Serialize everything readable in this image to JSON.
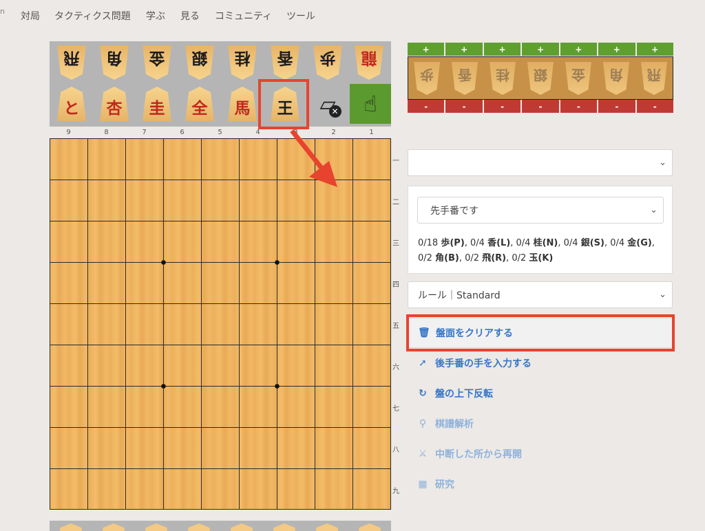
{
  "nav": {
    "items": [
      "対局",
      "タクティクス問題",
      "学ぶ",
      "見る",
      "コミュニティ",
      "ツール"
    ]
  },
  "palette": {
    "top_row": [
      {
        "glyph": "飛",
        "style": "black",
        "inverted": true,
        "icon": "rook-piece-icon"
      },
      {
        "glyph": "角",
        "style": "black",
        "inverted": true,
        "icon": "bishop-piece-icon"
      },
      {
        "glyph": "金",
        "style": "black",
        "inverted": true,
        "icon": "gold-piece-icon"
      },
      {
        "glyph": "銀",
        "style": "black",
        "inverted": true,
        "icon": "silver-piece-icon"
      },
      {
        "glyph": "桂",
        "style": "black",
        "inverted": true,
        "icon": "knight-piece-icon"
      },
      {
        "glyph": "香",
        "style": "black",
        "inverted": true,
        "icon": "lance-piece-icon"
      },
      {
        "glyph": "歩",
        "style": "black",
        "inverted": true,
        "icon": "pawn-piece-icon"
      },
      {
        "glyph": "龍",
        "style": "red",
        "inverted": true,
        "icon": "dragon-piece-icon"
      }
    ],
    "bottom_row": [
      {
        "glyph": "と",
        "style": "red",
        "inverted": false,
        "icon": "tokin-piece-icon"
      },
      {
        "glyph": "杏",
        "style": "red",
        "inverted": false,
        "icon": "promoted-lance-piece-icon"
      },
      {
        "glyph": "圭",
        "style": "red",
        "inverted": false,
        "icon": "promoted-knight-piece-icon"
      },
      {
        "glyph": "全",
        "style": "red",
        "inverted": false,
        "icon": "promoted-silver-piece-icon"
      },
      {
        "glyph": "馬",
        "style": "red",
        "inverted": false,
        "icon": "horse-piece-icon"
      },
      {
        "glyph": "王",
        "style": "black",
        "inverted": false,
        "icon": "king-piece-icon"
      }
    ],
    "tools": {
      "trash_icon": "trash-icon",
      "hand_icon": "hand-pointer-icon"
    }
  },
  "board": {
    "col_numbers": [
      "9",
      "8",
      "7",
      "6",
      "5",
      "4",
      "3",
      "2",
      "1"
    ],
    "row_numbers": [
      "一",
      "二",
      "三",
      "四",
      "五",
      "六",
      "七",
      "八",
      "九"
    ]
  },
  "hand_counter": {
    "plus_label": "+",
    "minus_label": "-",
    "pieces": [
      "歩",
      "香",
      "桂",
      "銀",
      "金",
      "角",
      "飛"
    ]
  },
  "panel": {
    "top_select_value": "",
    "turn_select_value": "先手番です",
    "piece_counts": [
      {
        "text": "0/18",
        "label": "歩(P)",
        "sep": ", "
      },
      {
        "text": "0/4",
        "label": "香(L)",
        "sep": ", "
      },
      {
        "text": "0/4",
        "label": "桂(N)",
        "sep": ", "
      },
      {
        "text": "0/4",
        "label": "銀(S)",
        "sep": ", "
      },
      {
        "text": "0/4",
        "label": "金(G)",
        "sep": ","
      },
      {
        "text": "0/2",
        "label": "角(B)",
        "sep": ", "
      },
      {
        "text": "0/2",
        "label": "飛(R)",
        "sep": ", "
      },
      {
        "text": "0/2",
        "label": "玉(K)",
        "sep": ""
      }
    ],
    "rule_select_value": "ルール｜Standard"
  },
  "actions": {
    "clear_board": "盤面をクリアする",
    "gote_input": "後手番の手を入力する",
    "flip_board": "盤の上下反転",
    "analysis": "棋譜解析",
    "resume": "中断した所から再開",
    "study": "研究"
  },
  "colors": {
    "annotation": "#e8432e",
    "link": "#3676c8",
    "plus": "#5f9f30",
    "minus": "#c03a34"
  }
}
